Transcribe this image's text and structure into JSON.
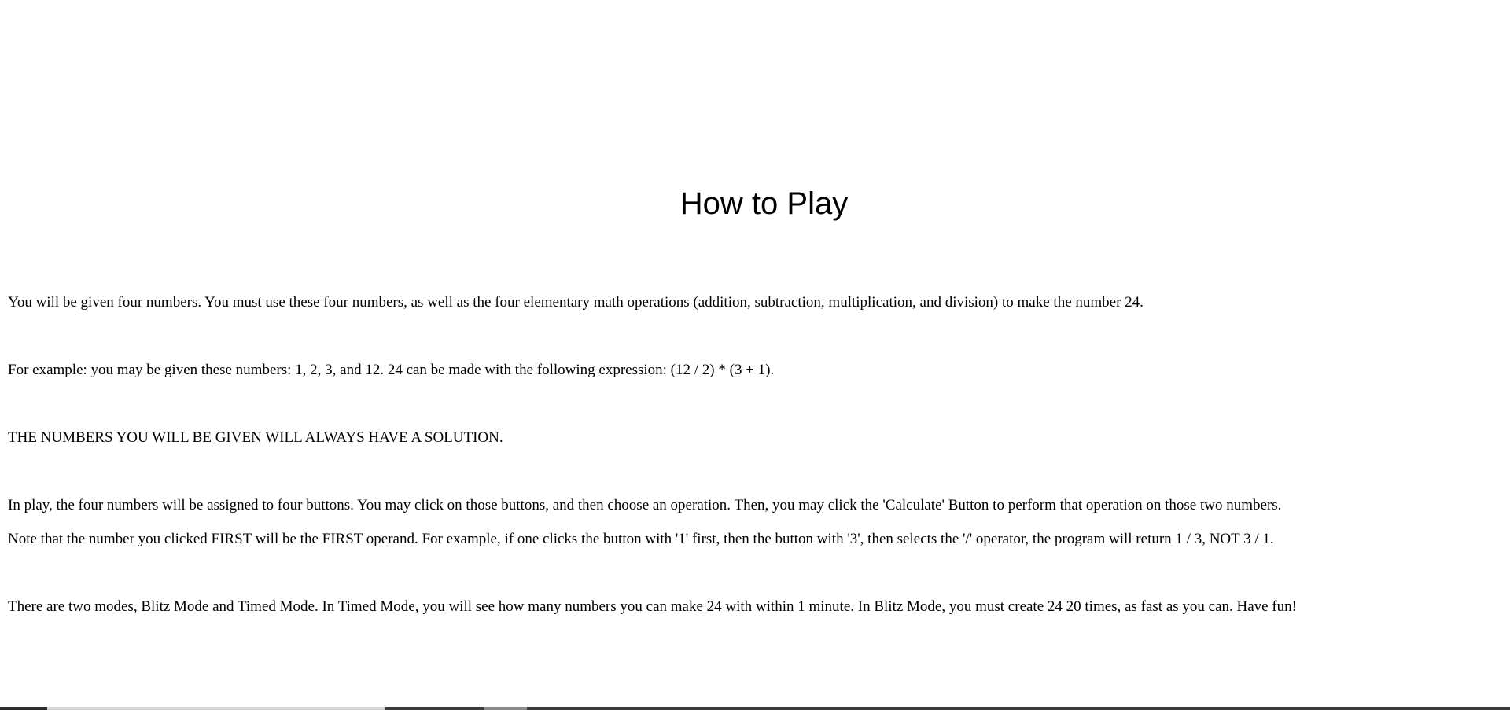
{
  "title": "How to Play",
  "paragraphs": {
    "intro": "You will be given four numbers. You must use these four numbers, as well as the four elementary math operations (addition, subtraction, multiplication, and division) to make the number 24.",
    "example": "For example: you may be given these numbers: 1, 2, 3, and 12. 24 can be made with the following expression: (12 / 2) * (3 + 1).",
    "solution_note": "THE NUMBERS YOU WILL BE GIVEN WILL ALWAYS HAVE A SOLUTION.",
    "play_line1": "In play, the four numbers will be assigned to four buttons. You may click on those buttons, and then choose an operation. Then, you may click the 'Calculate' Button to perform that operation on those two numbers.",
    "play_line2": "Note that the number you clicked FIRST will be the FIRST operand. For example, if one clicks the button with '1' first, then the button with '3', then selects the '/' operator, the program will return 1 / 3, NOT 3 / 1.",
    "modes": "There are two modes, Blitz Mode and Timed Mode. In Timed Mode, you will see how many numbers you can make 24 with within 1 minute. In Blitz Mode, you must create 24 20 times, as fast as you can. Have fun!"
  },
  "colors": {
    "background": "#ffffff",
    "text": "#000000"
  }
}
